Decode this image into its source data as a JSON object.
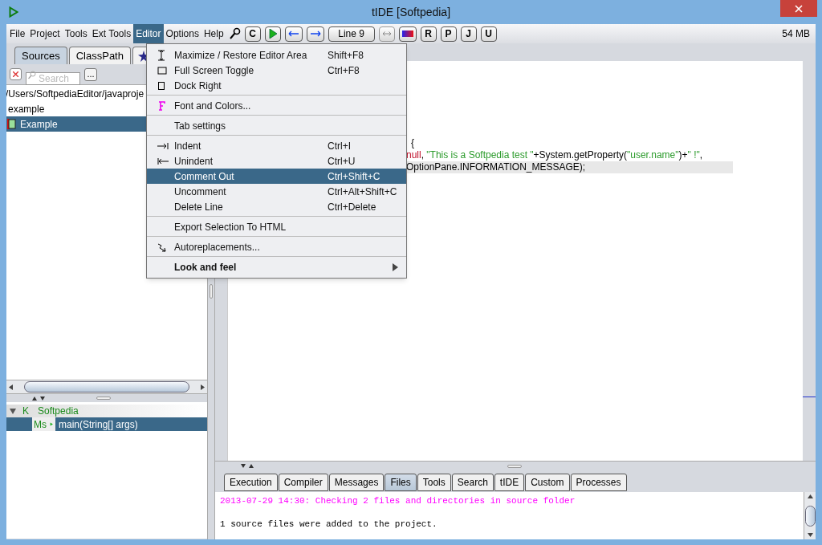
{
  "window": {
    "title": "tIDE [Softpedia]"
  },
  "menu_bar": [
    {
      "label": "File",
      "selected": false
    },
    {
      "label": "Project",
      "selected": false
    },
    {
      "label": "Tools",
      "selected": false
    },
    {
      "label": "Ext Tools",
      "selected": false
    },
    {
      "label": "Editor",
      "selected": true
    },
    {
      "label": "Options",
      "selected": false
    },
    {
      "label": "Help",
      "selected": false
    }
  ],
  "toolbar": [
    {
      "kind": "search"
    },
    {
      "kind": "letter",
      "label": "C"
    },
    {
      "kind": "run"
    },
    {
      "kind": "back"
    },
    {
      "kind": "forward"
    },
    {
      "kind": "wide",
      "label": "Line 9"
    },
    {
      "kind": "swap"
    },
    {
      "kind": "color"
    },
    {
      "kind": "letter",
      "label": "R"
    },
    {
      "kind": "letter",
      "label": "P"
    },
    {
      "kind": "letter",
      "label": "J"
    },
    {
      "kind": "letter",
      "label": "U"
    }
  ],
  "memory": "54 MB",
  "left_tabs": [
    {
      "kind": "text",
      "label": "Sources",
      "selected": true
    },
    {
      "kind": "text",
      "label": "ClassPath",
      "selected": false
    },
    {
      "kind": "star",
      "selected": false
    }
  ],
  "search": {
    "placeholder": "Search",
    "more_button": "..."
  },
  "files": [
    {
      "kind": "path",
      "label": "/Users/SoftpediaEditor/javaproje",
      "selected": false
    },
    {
      "kind": "folder",
      "label": "example",
      "selected": false
    },
    {
      "kind": "file",
      "label": "Example",
      "selected": true
    }
  ],
  "outline": [
    {
      "badge": "K",
      "label": "Softpedia",
      "expanded": true,
      "selected": false,
      "children": [
        {
          "badge": "Ms",
          "label": "main(String[] args)",
          "selected": true
        }
      ]
    }
  ],
  "code_lines": [
    {
      "highlighted": false,
      "segments": [
        {
          "kind": "plain",
          "text": "{"
        }
      ]
    },
    {
      "highlighted": false,
      "segments": [
        {
          "kind": "keyword",
          "text": "null"
        },
        {
          "kind": "plain",
          "text": ", "
        },
        {
          "kind": "string",
          "text": "\"This is a Softpedia test \""
        },
        {
          "kind": "plain",
          "text": "+System.getProperty("
        },
        {
          "kind": "string",
          "text": "\"user.name\""
        },
        {
          "kind": "plain",
          "text": ")+"
        },
        {
          "kind": "string",
          "text": "\" !\""
        },
        {
          "kind": "plain",
          "text": ","
        }
      ]
    },
    {
      "highlighted": true,
      "segments": [
        {
          "kind": "plain",
          "text": "OptionPane.INFORMATION_MESSAGE);"
        }
      ]
    }
  ],
  "editor_menu": [
    [
      {
        "kind": "maximize",
        "label": "Maximize / Restore Editor Area",
        "shortcut": "Shift+F8",
        "selected": false
      },
      {
        "kind": "fullscreen",
        "label": "Full Screen Toggle",
        "shortcut": "Ctrl+F8",
        "selected": false
      },
      {
        "kind": "dock",
        "label": "Dock Right",
        "selected": false
      }
    ],
    [
      {
        "kind": "font",
        "label": "Font and Colors...",
        "selected": false
      }
    ],
    [
      {
        "label": "Tab settings",
        "selected": false
      }
    ],
    [
      {
        "kind": "indent",
        "label": "Indent",
        "shortcut": "Ctrl+I",
        "selected": false
      },
      {
        "kind": "unindent",
        "label": "Unindent",
        "shortcut": "Ctrl+U",
        "selected": false
      },
      {
        "label": "Comment Out",
        "shortcut": "Ctrl+Shift+C",
        "selected": true
      },
      {
        "label": "Uncomment",
        "shortcut": "Ctrl+Alt+Shift+C",
        "selected": false
      },
      {
        "label": "Delete Line",
        "shortcut": "Ctrl+Delete",
        "selected": false
      }
    ],
    [
      {
        "label": "Export Selection To HTML",
        "selected": false
      }
    ],
    [
      {
        "kind": "autoreplace",
        "label": "Autoreplacements...",
        "selected": false
      }
    ],
    [
      {
        "label": "Look and feel",
        "bold": true,
        "submenu": true,
        "selected": false
      }
    ]
  ],
  "bottom_tabs": [
    {
      "label": "Execution",
      "selected": false
    },
    {
      "label": "Compiler",
      "selected": false
    },
    {
      "label": "Messages",
      "selected": false
    },
    {
      "label": "Files",
      "selected": true
    },
    {
      "label": "Tools",
      "selected": false
    },
    {
      "label": "Search",
      "selected": false
    },
    {
      "label": "tIDE",
      "selected": false
    },
    {
      "label": "Custom",
      "selected": false
    },
    {
      "label": "Processes",
      "selected": false
    }
  ],
  "output": [
    {
      "text": "2013-07-29 14:30: Checking 2 files and directories in source folder",
      "color": "#ff00ff"
    },
    {
      "text": "1 source files were added to the project.",
      "color": "#000000"
    }
  ]
}
